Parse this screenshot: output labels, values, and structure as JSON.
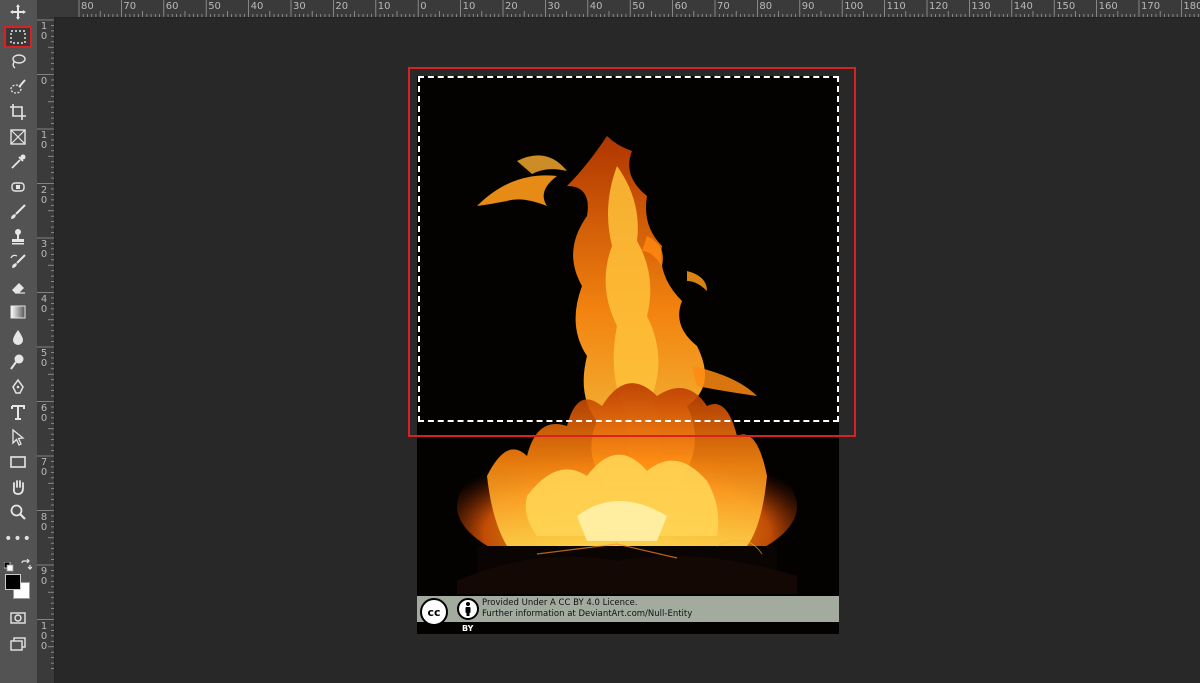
{
  "app": {
    "name": "Photoshop"
  },
  "toolbar": {
    "tools": [
      {
        "id": "move",
        "label": "Move Tool",
        "icon": "move-icon"
      },
      {
        "id": "marquee",
        "label": "Rectangular Marquee Tool",
        "icon": "marquee-icon",
        "active": true
      },
      {
        "id": "lasso",
        "label": "Lasso Tool",
        "icon": "lasso-icon"
      },
      {
        "id": "quick-select",
        "label": "Quick Selection Tool",
        "icon": "quick-select-icon"
      },
      {
        "id": "crop",
        "label": "Crop Tool",
        "icon": "crop-icon"
      },
      {
        "id": "frame",
        "label": "Frame Tool",
        "icon": "frame-icon"
      },
      {
        "id": "eyedropper",
        "label": "Eyedropper Tool",
        "icon": "eyedropper-icon"
      },
      {
        "id": "healing",
        "label": "Spot Healing Brush Tool",
        "icon": "bandage-icon"
      },
      {
        "id": "brush",
        "label": "Brush Tool",
        "icon": "brush-icon"
      },
      {
        "id": "stamp",
        "label": "Clone Stamp Tool",
        "icon": "stamp-icon"
      },
      {
        "id": "history-brush",
        "label": "History Brush Tool",
        "icon": "history-brush-icon"
      },
      {
        "id": "eraser",
        "label": "Eraser Tool",
        "icon": "eraser-icon"
      },
      {
        "id": "gradient",
        "label": "Gradient Tool",
        "icon": "gradient-icon"
      },
      {
        "id": "blur",
        "label": "Blur Tool",
        "icon": "blur-drop-icon"
      },
      {
        "id": "dodge",
        "label": "Dodge Tool",
        "icon": "dodge-icon"
      },
      {
        "id": "pen",
        "label": "Pen Tool",
        "icon": "pen-icon"
      },
      {
        "id": "type",
        "label": "Type Tool",
        "icon": "type-icon"
      },
      {
        "id": "path-select",
        "label": "Path Selection Tool",
        "icon": "arrow-icon"
      },
      {
        "id": "rectangle",
        "label": "Rectangle Tool",
        "icon": "rectangle-icon"
      },
      {
        "id": "hand",
        "label": "Hand Tool",
        "icon": "hand-icon"
      },
      {
        "id": "zoom",
        "label": "Zoom Tool",
        "icon": "zoom-icon"
      },
      {
        "id": "more",
        "label": "Edit Toolbar",
        "icon": "more-dots-icon",
        "text": "•••"
      }
    ],
    "colors": {
      "foreground": "#000000",
      "background": "#ffffff"
    }
  },
  "ruler_top": {
    "labels": [
      "80",
      "70",
      "60",
      "50",
      "40",
      "30",
      "20",
      "10",
      "0",
      "10",
      "20",
      "30",
      "40",
      "50",
      "60",
      "70",
      "80",
      "90",
      "100",
      "110",
      "120",
      "130",
      "140",
      "150",
      "160",
      "170",
      "180"
    ]
  },
  "ruler_left": {
    "labels": [
      "10",
      "0",
      "10",
      "20",
      "30",
      "40",
      "50",
      "60",
      "70",
      "80",
      "90",
      "100"
    ]
  },
  "watermark": {
    "cc": "cc",
    "by": "BY",
    "line1": "Provided Under A CC BY 4.0 Licence.",
    "line2": "Further information at DeviantArt.com/Null-Entity"
  },
  "colors": {
    "highlight": "#d62222",
    "toolbar": "#535353",
    "workspace": "#282828"
  }
}
